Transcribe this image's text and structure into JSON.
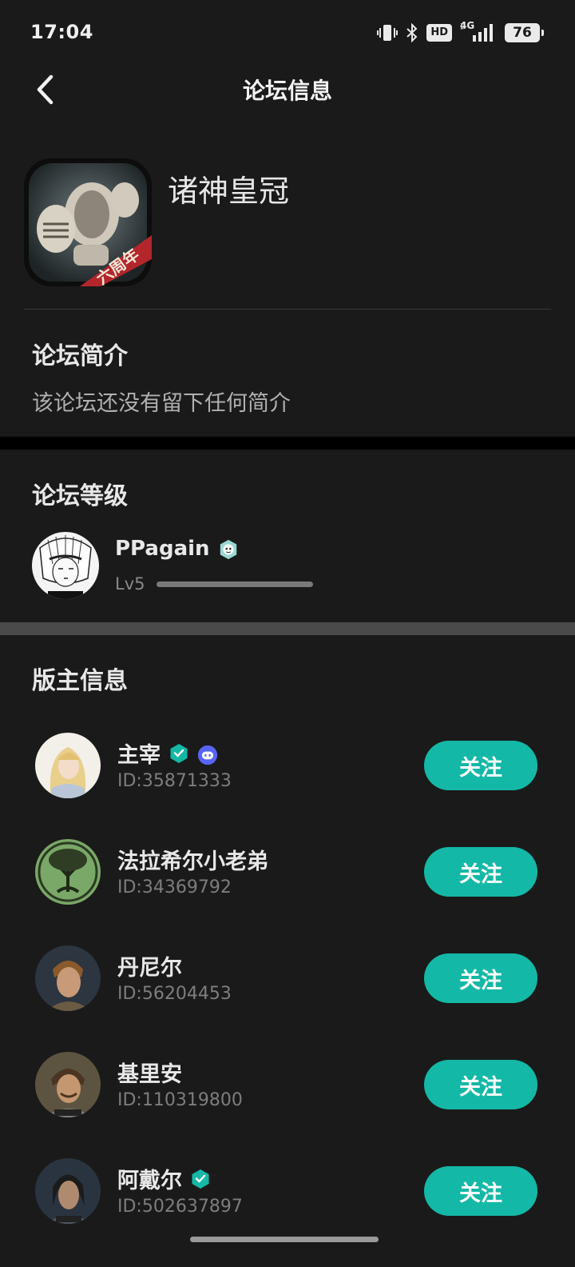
{
  "status_bar": {
    "time": "17:04",
    "hd": "HD",
    "network": "4G",
    "battery": "76"
  },
  "nav": {
    "title": "论坛信息"
  },
  "forum": {
    "name": "诸神皇冠",
    "icon_ribbon": "六周年"
  },
  "intro": {
    "title": "论坛简介",
    "text": "该论坛还没有留下任何简介"
  },
  "level": {
    "title": "论坛等级",
    "user_name": "PPagain",
    "level_label": "Lv5",
    "progress": 1.0
  },
  "moderators": {
    "title": "版主信息",
    "follow_label": "关注",
    "items": [
      {
        "name": "主宰",
        "id": "ID:35871333",
        "verified": true,
        "extra_badge": "discord-icon"
      },
      {
        "name": "法拉希尔小老弟",
        "id": "ID:34369792",
        "verified": false
      },
      {
        "name": "丹尼尔",
        "id": "ID:56204453",
        "verified": false
      },
      {
        "name": "基里安",
        "id": "ID:110319800",
        "verified": false
      },
      {
        "name": "阿戴尔",
        "id": "ID:502637897",
        "verified": true
      }
    ]
  },
  "colors": {
    "accent": "#14b8a6",
    "background": "#1a1a1a",
    "badge": "#14b8a6",
    "discord": "#5865f2"
  }
}
